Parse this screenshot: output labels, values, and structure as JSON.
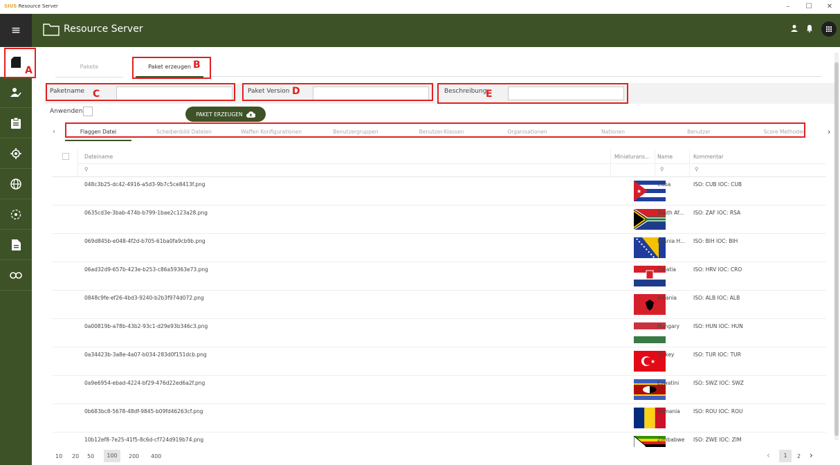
{
  "window": {
    "brand": "SIUS",
    "title": "Resource Server",
    "minimize": "–",
    "maximize": "☐",
    "close": "✕"
  },
  "appbar": {
    "title": "Resource Server"
  },
  "tabs": [
    {
      "label": "Pakete"
    },
    {
      "label": "Paket erzeugen"
    }
  ],
  "form": {
    "paketname_label": "Paketname",
    "version_label": "Paket Version",
    "beschreibung_label": "Beschreibung",
    "anwenden_label": "Anwenden",
    "create_button": "PAKET ERZEUGEN"
  },
  "subtabs": [
    "Flaggen Datei",
    "Scheibenbild Dateien",
    "Waffen Konfigurationen",
    "Benutzergruppen",
    "Benutzer-Klassen",
    "Organisationen",
    "Nationen",
    "Benutzer",
    "Score Methoden"
  ],
  "annotations": {
    "a": "A",
    "b": "B",
    "c": "C",
    "d": "D",
    "e": "E"
  },
  "table": {
    "headers": {
      "file": "Dateiname",
      "thumb": "Miniaturans...",
      "name": "Name",
      "comment": "Kommentar"
    },
    "rows": [
      {
        "file": "048c3b25-dc42-4916-a5d3-9b7c5ce8413f.png",
        "name": "Cuba",
        "comment": "ISO: CUB IOC: CUB",
        "flag": "cuba"
      },
      {
        "file": "0635cd3e-3bab-474b-b799-1bae2c123a28.png",
        "name": "South Af...",
        "comment": "ISO: ZAF IOC: RSA",
        "flag": "southafrica"
      },
      {
        "file": "069d845b-e048-4f2d-b705-61ba0fa9cb9b.png",
        "name": "Bosnia H...",
        "comment": "ISO: BIH IOC: BIH",
        "flag": "bosnia"
      },
      {
        "file": "06ad32d9-657b-423e-b253-c86a59363e73.png",
        "name": "Croatia",
        "comment": "ISO: HRV IOC: CRO",
        "flag": "croatia"
      },
      {
        "file": "0848c9fe-ef26-4bd3-9240-b2b3f974d072.png",
        "name": "Albania",
        "comment": "ISO: ALB IOC: ALB",
        "flag": "albania"
      },
      {
        "file": "0a00819b-a78b-43b2-93c1-d29e93b346c3.png",
        "name": "Hungary",
        "comment": "ISO: HUN IOC: HUN",
        "flag": "hungary"
      },
      {
        "file": "0a34423b-3a8e-4a07-b034-283d0f151dcb.png",
        "name": "Turkey",
        "comment": "ISO: TUR IOC: TUR",
        "flag": "turkey"
      },
      {
        "file": "0a9e6954-ebad-4224-bf29-476d22ed6a2f.png",
        "name": "Eswatini",
        "comment": "ISO: SWZ IOC: SWZ",
        "flag": "eswatini"
      },
      {
        "file": "0b683bc8-5678-48df-9845-b09fd46263cf.png",
        "name": "Romania",
        "comment": "ISO: ROU IOC: ROU",
        "flag": "romania"
      },
      {
        "file": "10b12ef8-7e25-41f5-8c6d-cf724d919b74.png",
        "name": "Zimbabwe",
        "comment": "ISO: ZWE IOC: ZIM",
        "flag": "zimbabwe"
      }
    ]
  },
  "pagination": {
    "sizes": [
      "10",
      "20",
      "50",
      "100",
      "200",
      "400"
    ],
    "selected_size": "100",
    "pages": [
      "1",
      "2"
    ],
    "current_page": "1"
  },
  "colors": {
    "primary": "#3e5227",
    "annotation": "#e02020"
  }
}
